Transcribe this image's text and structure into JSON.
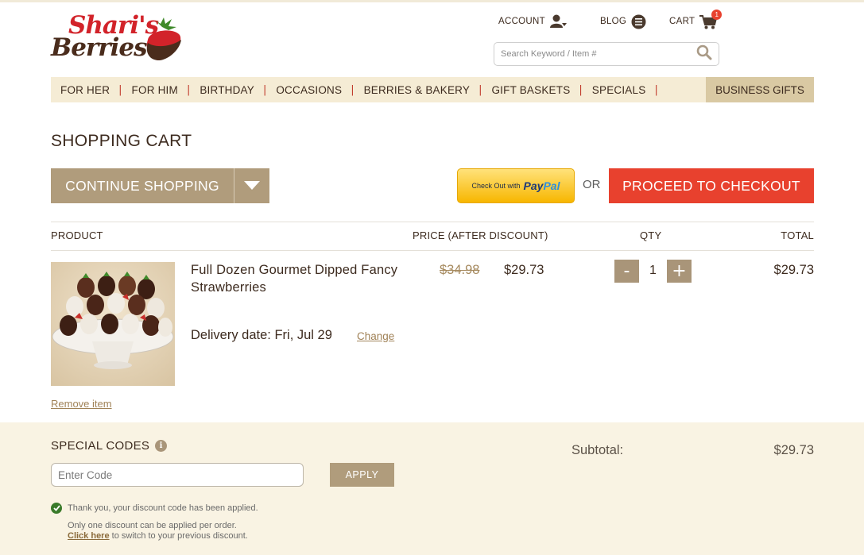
{
  "brand": {
    "line1": "Shari's",
    "line2": "Berries"
  },
  "header": {
    "account_label": "ACCOUNT",
    "blog_label": "BLOG",
    "cart_label": "CART",
    "cart_count": "1",
    "search_placeholder": "Search Keyword / Item #"
  },
  "nav": {
    "items": [
      "FOR HER",
      "FOR HIM",
      "BIRTHDAY",
      "OCCASIONS",
      "BERRIES & BAKERY",
      "GIFT BASKETS",
      "SPECIALS"
    ],
    "separator": "|",
    "business": "BUSINESS GIFTS"
  },
  "page": {
    "title": "SHOPPING CART",
    "continue_label": "CONTINUE SHOPPING",
    "paypal_prefix": "Check Out with",
    "paypal_brand_1": "Pay",
    "paypal_brand_2": "Pal",
    "or_label": "OR",
    "checkout_label": "PROCEED TO CHECKOUT"
  },
  "table": {
    "headers": {
      "product": "PRODUCT",
      "price": "PRICE (AFTER DISCOUNT)",
      "qty": "QTY",
      "total": "TOTAL"
    }
  },
  "cart_item": {
    "name": "Full Dozen Gourmet Dipped Fancy Strawberries",
    "delivery": "Delivery date: Fri, Jul 29",
    "change_label": "Change",
    "old_price": "$34.98",
    "new_price": "$29.73",
    "qty": "1",
    "minus": "-",
    "plus": "+",
    "total": "$29.73",
    "remove_label": "Remove item"
  },
  "codes": {
    "label": "SPECIAL CODES",
    "info": "i",
    "placeholder": "Enter Code",
    "apply_label": "APPLY",
    "success": "Thank you, your discount code has been applied.",
    "note1": "Only one discount can be applied per order.",
    "note2_link": "Click here",
    "note2_rest": " to switch to your previous discount."
  },
  "summary": {
    "subtotal_label": "Subtotal:",
    "subtotal_value": "$29.73"
  },
  "colors": {
    "accent": "#e8412e",
    "tan": "#b09c7c",
    "nav_bg": "#f5ecd5",
    "bottom_bg": "#f9f3e3"
  }
}
